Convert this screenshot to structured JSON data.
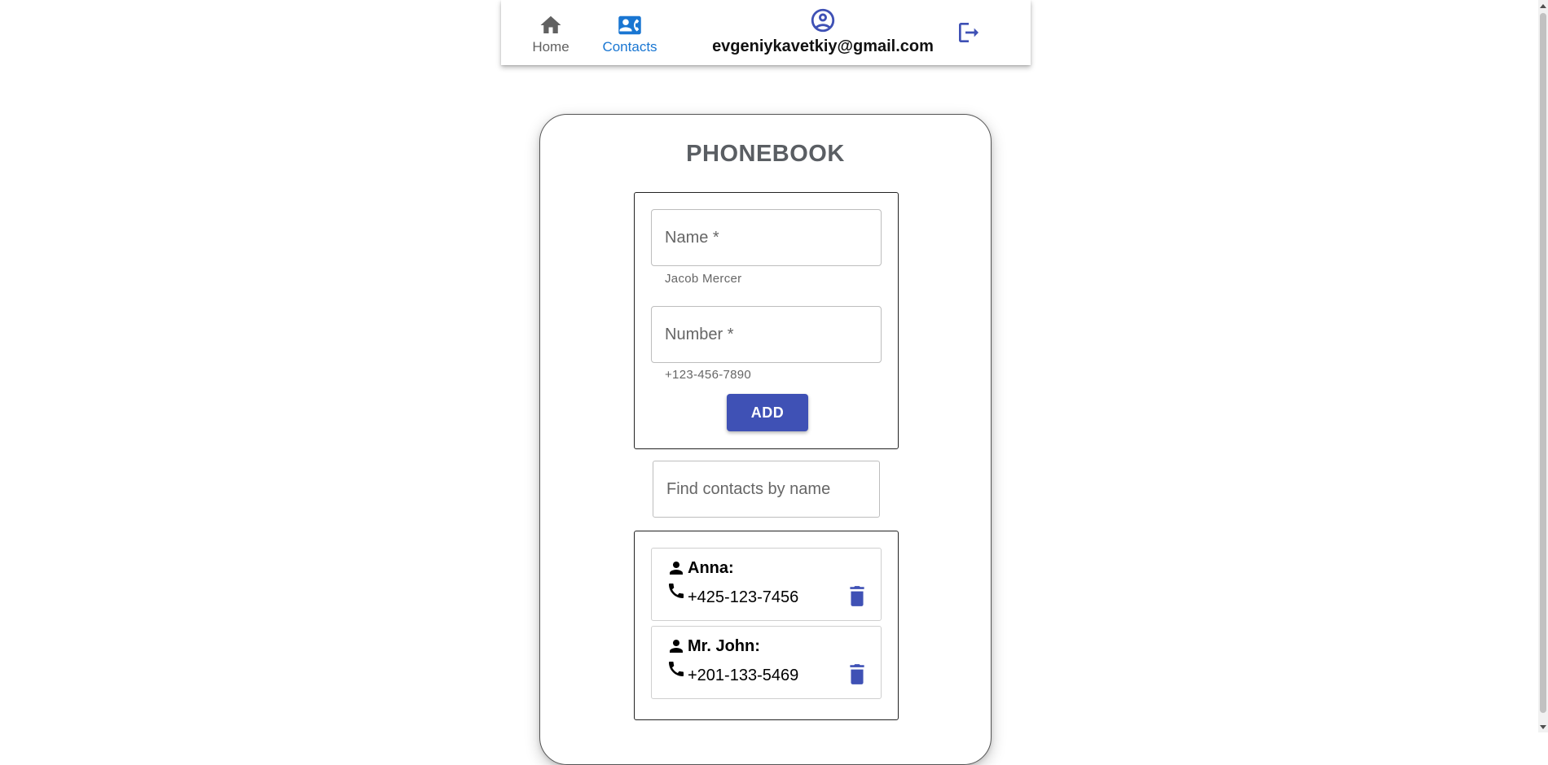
{
  "nav": {
    "home_label": "Home",
    "contacts_label": "Contacts",
    "user_email": "evgeniykavetkiy@gmail.com",
    "icons": {
      "home": "home-icon",
      "contacts": "contacts-icon",
      "user": "account-circle-icon",
      "logout": "logout-icon"
    },
    "active_tab": "Contacts",
    "colors": {
      "active": "#1976d2",
      "inactive": "#616161",
      "accent": "#3f51b5"
    }
  },
  "card": {
    "title": "PHONEBOOK"
  },
  "form": {
    "name_placeholder": "Name *",
    "name_helper": "Jacob Mercer",
    "number_placeholder": "Number *",
    "number_helper": "+123-456-7890",
    "add_label": "ADD",
    "button_color": "#3f51b5"
  },
  "search": {
    "placeholder": "Find contacts by name"
  },
  "contacts": [
    {
      "name": "Anna:",
      "phone": "+425-123-7456"
    },
    {
      "name": "Mr. John:",
      "phone": "+201-133-5469"
    }
  ]
}
